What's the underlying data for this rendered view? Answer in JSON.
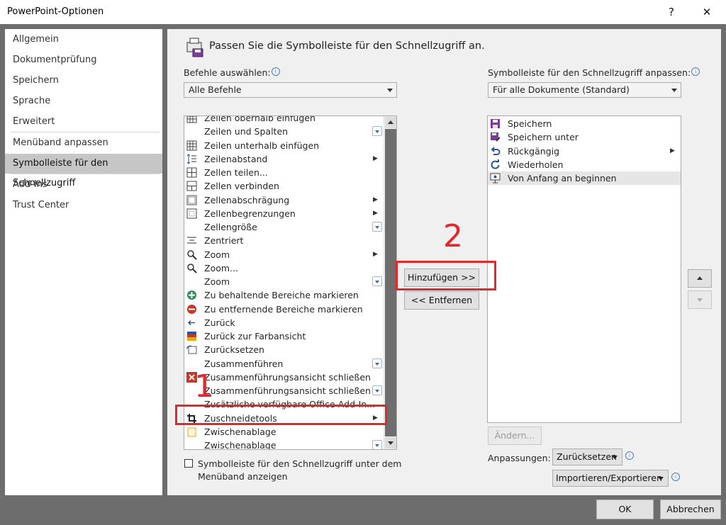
{
  "window": {
    "title": "PowerPoint-Optionen",
    "help": "?",
    "close": "✕"
  },
  "nav": [
    {
      "label": "Allgemein"
    },
    {
      "label": "Dokumentprüfung"
    },
    {
      "label": "Speichern"
    },
    {
      "label": "Sprache"
    },
    {
      "label": "Erweitert"
    },
    {
      "label": "Menüband anpassen"
    },
    {
      "label": "Symbolleiste für den Schnellzugriff",
      "selected": true
    },
    {
      "label": "Add-Ins"
    },
    {
      "label": "Trust Center"
    }
  ],
  "main": {
    "heading": "Passen Sie die Symbolleiste für den Schnellzugriff an.",
    "commands_label": "Befehle auswählen:",
    "commands_value": "Alle Befehle",
    "qat_label": "Symbolleiste für den Schnellzugriff anpassen:",
    "qat_value": "Für alle Dokumente (Standard)",
    "commands": [
      {
        "label": "Zeilen oberhalb einfügen",
        "icon": "table-insert-icon",
        "sub": ""
      },
      {
        "label": "Zeilen und Spalten",
        "icon": "",
        "sub": "dropdown"
      },
      {
        "label": "Zeilen unterhalb einfügen",
        "icon": "table-insert-icon",
        "sub": ""
      },
      {
        "label": "Zeilenabstand",
        "icon": "line-spacing-icon",
        "sub": "arrow"
      },
      {
        "label": "Zellen teilen...",
        "icon": "split-cells-icon",
        "sub": ""
      },
      {
        "label": "Zellen verbinden",
        "icon": "merge-cells-icon",
        "sub": ""
      },
      {
        "label": "Zellenabschrägung",
        "icon": "bevel-icon",
        "sub": "arrow"
      },
      {
        "label": "Zellenbegrenzungen",
        "icon": "borders-icon",
        "sub": "arrow"
      },
      {
        "label": "Zellengröße",
        "icon": "",
        "sub": "dropdown"
      },
      {
        "label": "Zentriert",
        "icon": "align-center-icon",
        "sub": ""
      },
      {
        "label": "Zoom",
        "icon": "zoom-icon",
        "sub": "arrow"
      },
      {
        "label": "Zoom...",
        "icon": "zoom-icon",
        "sub": ""
      },
      {
        "label": "Zoom",
        "icon": "",
        "sub": "dropdown"
      },
      {
        "label": "Zu behaltende Bereiche markieren",
        "icon": "mark-keep-icon",
        "sub": ""
      },
      {
        "label": "Zu entfernende Bereiche markieren",
        "icon": "mark-remove-icon",
        "sub": ""
      },
      {
        "label": "Zurück",
        "icon": "back-arrow-icon",
        "sub": ""
      },
      {
        "label": "Zurück zur Farbansicht",
        "icon": "color-view-icon",
        "sub": ""
      },
      {
        "label": "Zurücksetzen",
        "icon": "reset-icon",
        "sub": ""
      },
      {
        "label": "Zusammenführen",
        "icon": "",
        "sub": "dropdown"
      },
      {
        "label": "Zusammenführungsansicht schließen",
        "icon": "close-red-icon",
        "sub": ""
      },
      {
        "label": "Zusammenführungsansicht schließen",
        "icon": "",
        "sub": "dropdown"
      },
      {
        "label": "Zusätzliche verfügbare Office-Add-In...",
        "icon": "",
        "sub": ""
      },
      {
        "label": "Zuschneidetools",
        "icon": "crop-icon",
        "sub": "arrow"
      },
      {
        "label": "Zwischenablage",
        "icon": "clipboard-icon",
        "sub": ""
      },
      {
        "label": "Zwischenablage",
        "icon": "",
        "sub": "dropdown"
      }
    ],
    "qat_items": [
      {
        "label": "Speichern",
        "icon": "save-icon"
      },
      {
        "label": "Speichern unter",
        "icon": "save-as-icon"
      },
      {
        "label": "Rückgängig",
        "icon": "undo-icon"
      },
      {
        "label": "Wiederholen",
        "icon": "redo-icon"
      },
      {
        "label": "Von Anfang an beginnen",
        "icon": "presentation-icon"
      }
    ],
    "add_button": "Hinzufügen >>",
    "remove_button": "<< Entfernen",
    "modify_button": "Ändern...",
    "customizations_label": "Anpassungen:",
    "reset_button": "Zurücksetzen",
    "import_export_button": "Importieren/Exportieren",
    "checkbox_label_1": "Symbolleiste für den Schnellzugriff unter dem",
    "checkbox_label_2": "Menüband anzeigen",
    "annotation_1": "1",
    "annotation_2": "2"
  },
  "footer": {
    "ok": "OK",
    "cancel": "Abbrechen"
  },
  "colors": {
    "accent_red": "#e0282d",
    "selected_nav": "#c6c6c6",
    "panel": "#f0f0f0"
  }
}
